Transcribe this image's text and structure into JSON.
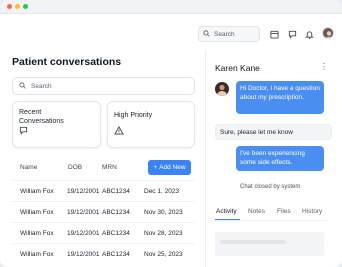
{
  "window": {
    "controls": [
      {
        "name": "close",
        "color": "#ff5f57"
      },
      {
        "name": "minimize",
        "color": "#febc2e"
      },
      {
        "name": "maximize",
        "color": "#28c840"
      }
    ]
  },
  "topbar": {
    "search_placeholder": "Search"
  },
  "page": {
    "title": "Patient conversations",
    "search_placeholder": "Search"
  },
  "cards": [
    {
      "label": "Recent Conversations",
      "icon": "chat-bubble-icon"
    },
    {
      "label": "High Priority",
      "icon": "warning-icon"
    }
  ],
  "table": {
    "columns": [
      "Name",
      "DOB",
      "MRN"
    ],
    "add_button_label": "Add New",
    "rows": [
      {
        "name": "William Fox",
        "dob": "19/12/2001",
        "mrn": "ABC1234",
        "date": "Dec 1, 2023"
      },
      {
        "name": "William Fox",
        "dob": "19/12/2001",
        "mrn": "ABC1234",
        "date": "Nov 30, 2023"
      },
      {
        "name": "William Fox",
        "dob": "19/12/2001",
        "mrn": "ABC1234",
        "date": "Nov 28, 2023"
      },
      {
        "name": "William Fox",
        "dob": "19/12/2001",
        "mrn": "ABC1234",
        "date": "Nov 25, 2023"
      }
    ]
  },
  "chat": {
    "contact_name": "Karen Kane",
    "messages": [
      {
        "from": "patient",
        "text": "Hi Doctor, I have a question about my prescription."
      },
      {
        "from": "doctor",
        "text": "Sure, please let me know"
      },
      {
        "from": "patient",
        "text": "I've been experiencing some side effects."
      }
    ],
    "closed_text": "Chat closed by system",
    "tabs": [
      "Activity",
      "Notes",
      "Files",
      "History"
    ],
    "active_tab": "Activity"
  },
  "colors": {
    "accent": "#3b82f6",
    "bubble_blue": "#4b8ef2"
  }
}
